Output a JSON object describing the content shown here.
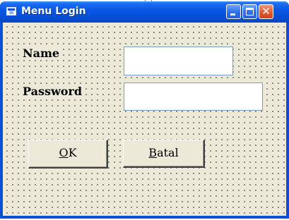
{
  "window": {
    "title": "Menu Login",
    "controls": {
      "minimize": "minimize",
      "maximize": "maximize",
      "close_glyph": "✕"
    },
    "icons": [
      "app-icon",
      "minimize-icon",
      "maximize-icon",
      "close-icon"
    ]
  },
  "form": {
    "name_label": "Name",
    "password_label": "Password",
    "name_value": "",
    "password_value": "",
    "ok_accel": "O",
    "ok_rest": "K",
    "batal_accel": "B",
    "batal_rest": "atal"
  },
  "colors": {
    "titlebar": "#0a58e6",
    "form_bg": "#ece9d8",
    "close_button": "#e25a2f"
  }
}
